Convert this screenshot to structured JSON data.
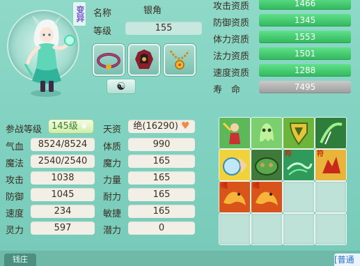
{
  "pet": {
    "seal_text": "变异",
    "name_label": "名称",
    "name_value": "银角",
    "level_label": "等级",
    "level_value": "155"
  },
  "aptitudes": [
    {
      "label": "攻击资质",
      "value": "1466",
      "style": "green"
    },
    {
      "label": "防御资质",
      "value": "1345",
      "style": "green"
    },
    {
      "label": "体力资质",
      "value": "1553",
      "style": "green"
    },
    {
      "label": "法力资质",
      "value": "1501",
      "style": "green"
    },
    {
      "label": "速度资质",
      "value": "1288",
      "style": "green"
    },
    {
      "label": "寿　命",
      "value": "7495",
      "style": "gray"
    }
  ],
  "equipment": [
    {
      "name": "pet-collar-icon"
    },
    {
      "name": "pet-armor-icon"
    },
    {
      "name": "pet-necklace-icon"
    }
  ],
  "yinyang_icon": "☯",
  "battle_level": {
    "label": "参战等级",
    "value": "145级"
  },
  "talent": {
    "label": "天资",
    "value": "绝(16290)",
    "icon": "heart-icon"
  },
  "stats_left": [
    {
      "label": "气血",
      "value": "8524/8524"
    },
    {
      "label": "魔法",
      "value": "2540/2540"
    },
    {
      "label": "攻击",
      "value": "1038"
    },
    {
      "label": "防御",
      "value": "1045"
    },
    {
      "label": "速度",
      "value": "234"
    },
    {
      "label": "灵力",
      "value": "597"
    }
  ],
  "stats_right": [
    {
      "label": "体质",
      "value": "990"
    },
    {
      "label": "魔力",
      "value": "165"
    },
    {
      "label": "力量",
      "value": "165"
    },
    {
      "label": "耐力",
      "value": "165"
    },
    {
      "label": "敏捷",
      "value": "165"
    },
    {
      "label": "潜力",
      "value": "0"
    }
  ],
  "skills": [
    {
      "name": "skill-strike-icon"
    },
    {
      "name": "skill-ghost-icon"
    },
    {
      "name": "skill-shield-icon"
    },
    {
      "name": "skill-slash-icon"
    },
    {
      "name": "skill-defense-orb-icon"
    },
    {
      "name": "skill-turtle-icon"
    },
    {
      "name": "skill-wind-icon",
      "tag": "符"
    },
    {
      "name": "skill-rage-icon",
      "tag": "符"
    },
    {
      "name": "skill-dragon-icon",
      "tag": "魂"
    },
    {
      "name": "skill-dragon-icon",
      "tag": "魂"
    }
  ],
  "bottom": {
    "tab": "钱庄",
    "chat": "[普通"
  },
  "colors": {
    "panel": "#8fd9c8",
    "green_bar": "#31b85c",
    "gray_bar": "#9d9d9d",
    "field": "#f2efe6"
  }
}
